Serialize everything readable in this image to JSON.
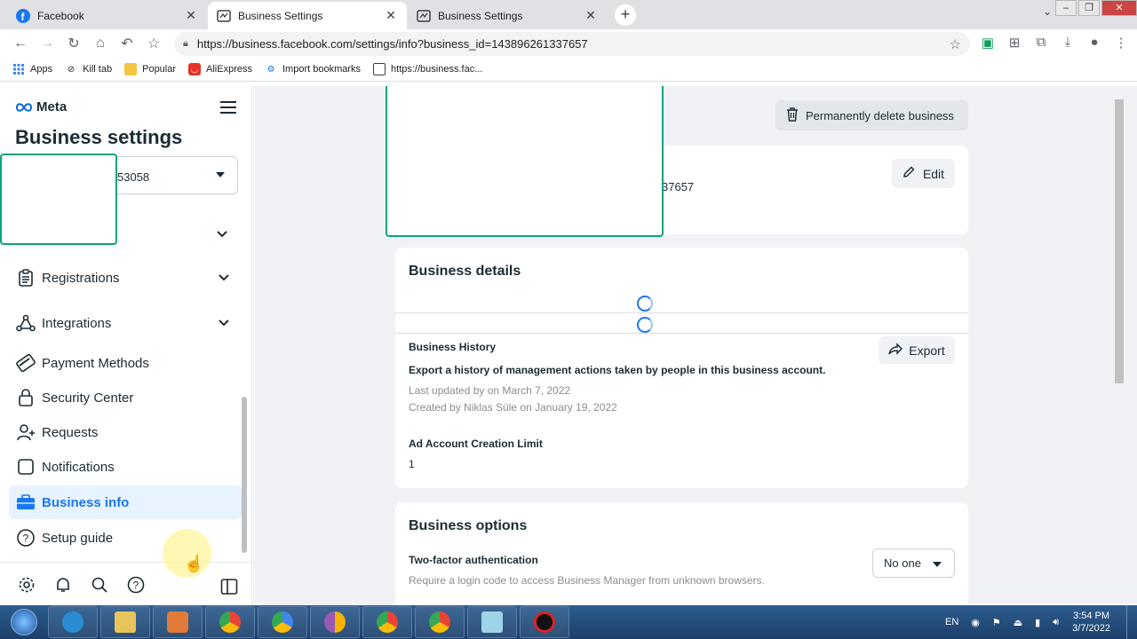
{
  "browser": {
    "tabs": [
      {
        "title": "Facebook",
        "icon": "facebook-icon"
      },
      {
        "title": "Business Settings",
        "icon": "business-settings-icon"
      },
      {
        "title": "Business Settings",
        "icon": "business-settings-icon"
      }
    ],
    "new_tab": "+",
    "url": "https://business.facebook.com/settings/info?business_id=143896261337657",
    "bookmarks": [
      {
        "label": "Apps"
      },
      {
        "label": "Kill tab"
      },
      {
        "label": "Popular"
      },
      {
        "label": "AliExpress"
      },
      {
        "label": "Import bookmarks"
      },
      {
        "label": "https://business.fac..."
      }
    ]
  },
  "sidebar": {
    "logo": "Meta",
    "title": "Business settings",
    "account_id_fragment": "53058",
    "items": [
      {
        "label": "Registrations",
        "icon": "clipboard-icon",
        "expandable": true
      },
      {
        "label": "Integrations",
        "icon": "integrations-icon",
        "expandable": true
      },
      {
        "label": "Payment Methods",
        "icon": "credit-card-icon",
        "expandable": false
      },
      {
        "label": "Security Center",
        "icon": "lock-icon",
        "expandable": false
      },
      {
        "label": "Requests",
        "icon": "person-add-icon",
        "expandable": false
      },
      {
        "label": "Notifications",
        "icon": "notifications-icon",
        "expandable": false
      },
      {
        "label": "Business info",
        "icon": "briefcase-icon",
        "expandable": false,
        "active": true
      },
      {
        "label": "Setup guide",
        "icon": "help-icon",
        "expandable": false
      }
    ],
    "bottom_icons": [
      "settings-icon",
      "bell-icon",
      "search-icon",
      "help-icon",
      "panel-toggle-icon"
    ]
  },
  "main": {
    "delete_button": "Permanently delete business",
    "id_fragment": "37657",
    "edit_label": "Edit",
    "business_details": {
      "title": "Business details",
      "history_title": "Business History",
      "history_desc": "Export a history of management actions taken by people in this business account.",
      "last_updated": "Last updated by on March 7, 2022",
      "created_by": "Created by Niklas Süle on January 19, 2022",
      "export_label": "Export",
      "ad_limit_title": "Ad Account Creation Limit",
      "ad_limit_value": "1"
    },
    "business_options": {
      "title": "Business options",
      "tfa_title": "Two-factor authentication",
      "tfa_desc": "Require a login code to access Business Manager from unknown browsers.",
      "tfa_value": "No one"
    }
  },
  "taskbar": {
    "language": "EN",
    "time": "3:54 PM",
    "date": "3/7/2022"
  },
  "colors": {
    "accent": "#1877f2",
    "overlay_border": "#0aa37f"
  }
}
